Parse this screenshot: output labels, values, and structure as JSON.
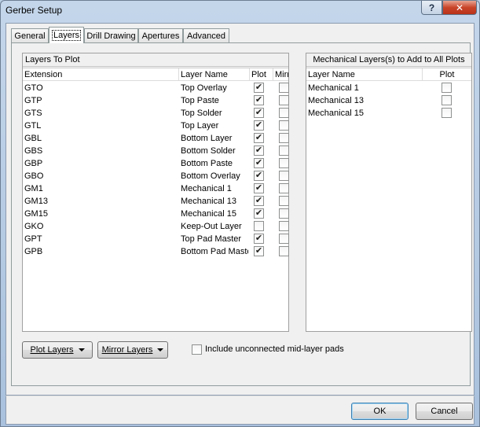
{
  "window": {
    "title": "Gerber Setup",
    "help_glyph": "?",
    "close_glyph": "✕"
  },
  "tabs": [
    {
      "label": "General"
    },
    {
      "label": "Layers"
    },
    {
      "label": "Drill Drawing"
    },
    {
      "label": "Apertures"
    },
    {
      "label": "Advanced"
    }
  ],
  "layers_group": {
    "title": "Layers To Plot",
    "headers": {
      "extension": "Extension",
      "layer_name": "Layer Name",
      "plot": "Plot",
      "mirror": "Mirror"
    },
    "rows": [
      {
        "extension": "GTO",
        "layer_name": "Top Overlay",
        "plot": true,
        "mirror": false
      },
      {
        "extension": "GTP",
        "layer_name": "Top Paste",
        "plot": true,
        "mirror": false
      },
      {
        "extension": "GTS",
        "layer_name": "Top Solder",
        "plot": true,
        "mirror": false
      },
      {
        "extension": "GTL",
        "layer_name": "Top Layer",
        "plot": true,
        "mirror": false
      },
      {
        "extension": "GBL",
        "layer_name": "Bottom Layer",
        "plot": true,
        "mirror": false
      },
      {
        "extension": "GBS",
        "layer_name": "Bottom Solder",
        "plot": true,
        "mirror": false
      },
      {
        "extension": "GBP",
        "layer_name": "Bottom Paste",
        "plot": true,
        "mirror": false
      },
      {
        "extension": "GBO",
        "layer_name": "Bottom Overlay",
        "plot": true,
        "mirror": false
      },
      {
        "extension": "GM1",
        "layer_name": "Mechanical 1",
        "plot": true,
        "mirror": false
      },
      {
        "extension": "GM13",
        "layer_name": "Mechanical 13",
        "plot": true,
        "mirror": false
      },
      {
        "extension": "GM15",
        "layer_name": "Mechanical 15",
        "plot": true,
        "mirror": false
      },
      {
        "extension": "GKO",
        "layer_name": "Keep-Out Layer",
        "plot": false,
        "mirror": false
      },
      {
        "extension": "GPT",
        "layer_name": "Top Pad Master",
        "plot": true,
        "mirror": false
      },
      {
        "extension": "GPB",
        "layer_name": "Bottom Pad Maste",
        "plot": true,
        "mirror": false
      }
    ]
  },
  "mech_group": {
    "title": "Mechanical Layers(s) to Add to All Plots",
    "headers": {
      "layer_name": "Layer Name",
      "plot": "Plot"
    },
    "rows": [
      {
        "layer_name": "Mechanical 1",
        "plot": false
      },
      {
        "layer_name": "Mechanical 13",
        "plot": false
      },
      {
        "layer_name": "Mechanical 15",
        "plot": false
      }
    ]
  },
  "controls": {
    "plot_layers_label": "Plot Layers",
    "mirror_layers_label": "Mirror Layers",
    "include_unconnected_label": "Include unconnected mid-layer pads",
    "include_unconnected_checked": false
  },
  "footer": {
    "ok_label": "OK",
    "cancel_label": "Cancel"
  },
  "check_glyph": "✔"
}
